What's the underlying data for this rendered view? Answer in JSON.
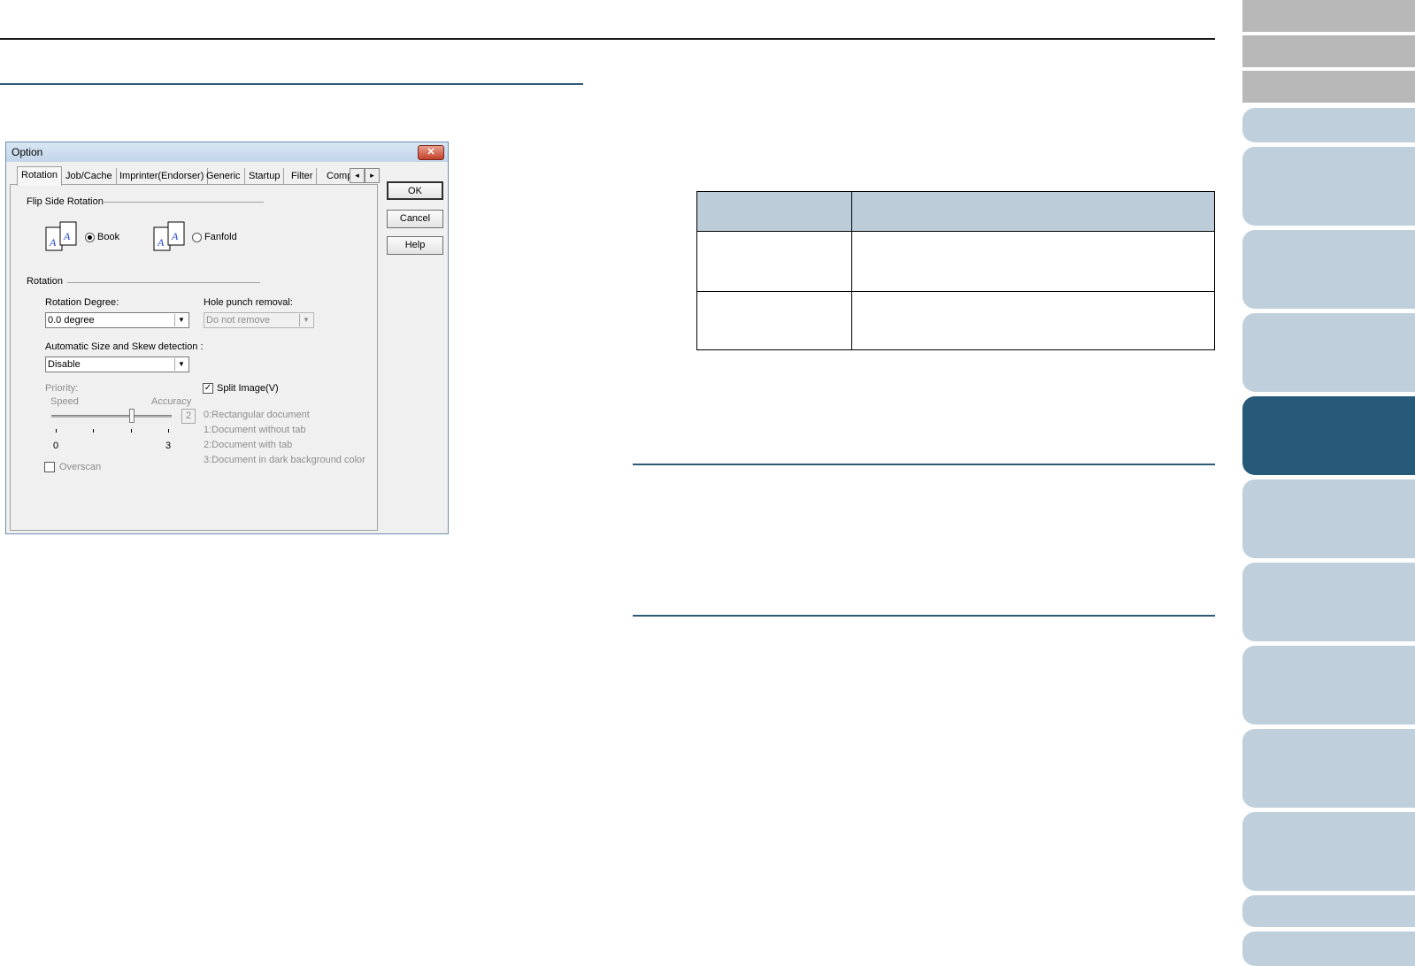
{
  "dialog": {
    "title": "Option",
    "close_glyph": "✕",
    "tabs": [
      "Rotation",
      "Job/Cache",
      "Imprinter(Endorser)",
      "Generic",
      "Startup",
      "Filter",
      "Compr"
    ],
    "tab_scroll_left": "◂",
    "tab_scroll_right": "▸",
    "buttons": {
      "ok": "OK",
      "cancel": "Cancel",
      "help": "Help"
    },
    "flip_side": {
      "group_label": "Flip Side Rotation",
      "book": "Book",
      "fanfold": "Fanfold",
      "selected": "Book"
    },
    "rotation": {
      "group_label": "Rotation",
      "degree_label": "Rotation Degree:",
      "degree_value": "0.0 degree",
      "hole_punch_label": "Hole punch removal:",
      "hole_punch_value": "Do not remove",
      "auto_detect_label": "Automatic Size and Skew detection :",
      "auto_detect_value": "Disable",
      "priority_label": "Priority:",
      "speed_label": "Speed",
      "accuracy_label": "Accuracy",
      "priority_value": "2",
      "priority_level": 2,
      "scale_min": "0",
      "scale_max": "3",
      "split_image_label": "Split Image(V)",
      "split_image_checked": true,
      "overscan_label": "Overscan",
      "overscan_checked": false,
      "split_options": [
        "0:Rectangular document",
        "1:Document without tab",
        "2:Document with tab",
        "3:Document in dark background color"
      ]
    },
    "dropdown_glyph": "▼",
    "check_glyph": "✓"
  },
  "colors": {
    "active_side_tab": "#265a78",
    "side_tab": "#bfd0dc",
    "table_header": "#bccdd9",
    "rule_blue": "#2e5a75"
  }
}
